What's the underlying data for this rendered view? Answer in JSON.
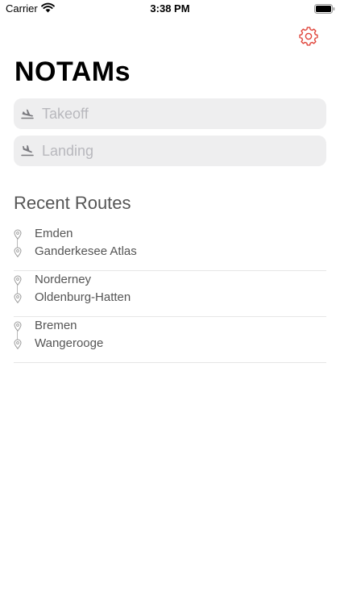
{
  "status_bar": {
    "carrier": "Carrier",
    "time": "3:38 PM"
  },
  "header": {
    "title": "NOTAMs",
    "settings_icon": "gear-icon",
    "accent_color": "#e0443a"
  },
  "search": {
    "takeoff": {
      "value": "",
      "placeholder": "Takeoff",
      "icon": "airplane-departure-icon"
    },
    "landing": {
      "value": "",
      "placeholder": "Landing",
      "icon": "airplane-arrival-icon"
    }
  },
  "recent_routes": {
    "title": "Recent Routes",
    "items": [
      {
        "from": "Emden",
        "to": "Ganderkesee Atlas"
      },
      {
        "from": "Norderney",
        "to": "Oldenburg-Hatten"
      },
      {
        "from": "Bremen",
        "to": "Wangerooge"
      }
    ]
  }
}
